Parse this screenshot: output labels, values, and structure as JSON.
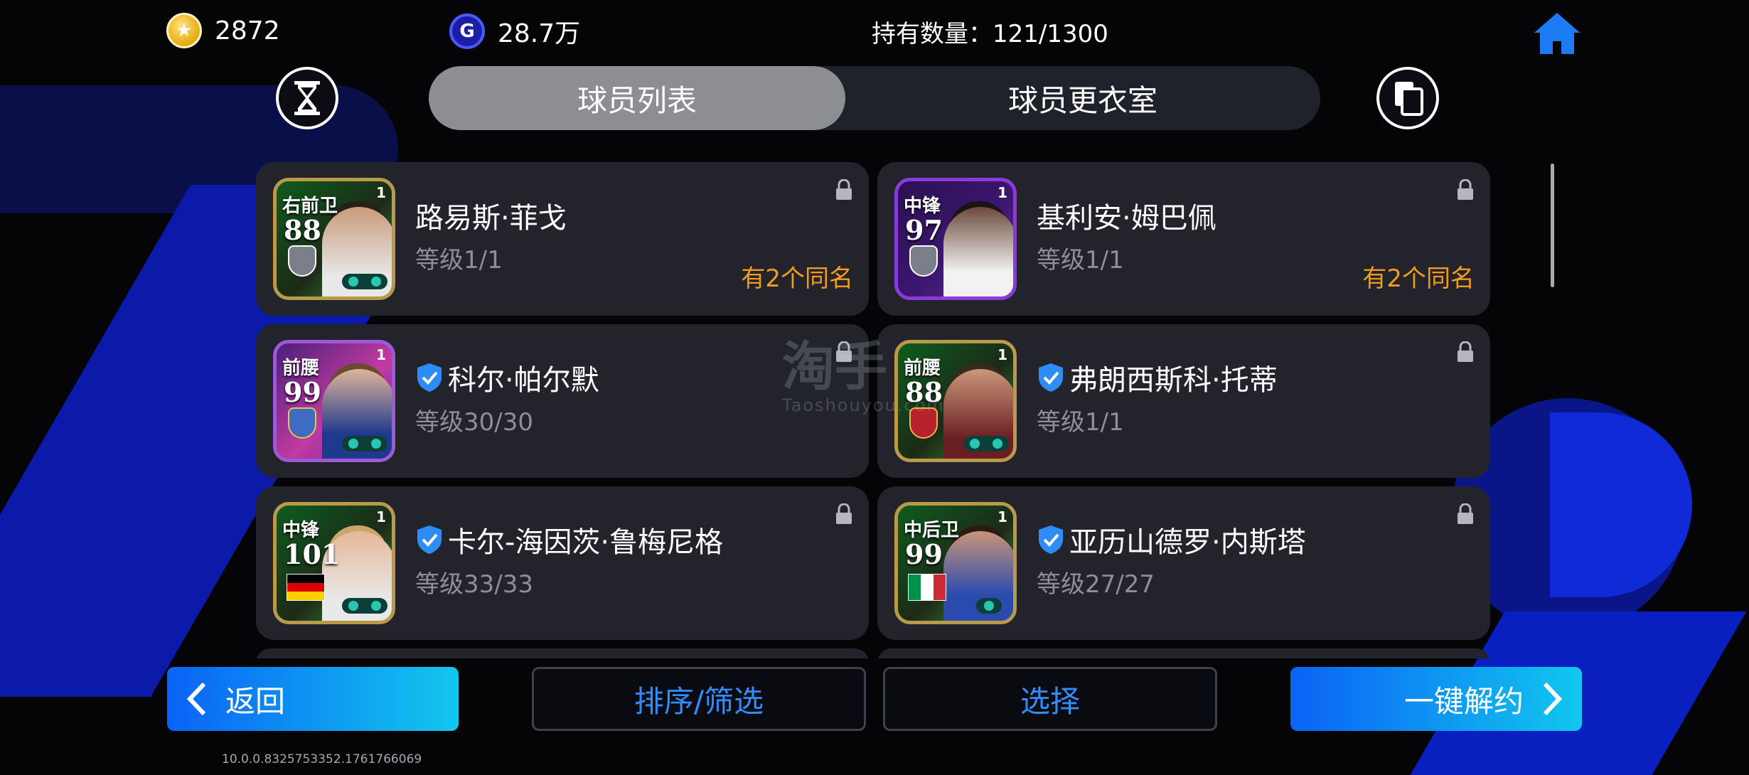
{
  "currency": {
    "coins": "2872",
    "gp": "28.7万",
    "holdings": "持有数量：121/1300"
  },
  "tabs": {
    "player_list": "球员列表",
    "locker_room": "球员更衣室"
  },
  "players": [
    {
      "position": "右前卫",
      "rating": "88",
      "name": "路易斯·菲戈",
      "level": "等级1/1",
      "duplicates": "有2个同名",
      "badge": "1"
    },
    {
      "position": "中锋",
      "rating": "97",
      "name": "基利安·姆巴佩",
      "level": "等级1/1",
      "duplicates": "有2个同名",
      "badge": "1"
    },
    {
      "position": "前腰",
      "rating": "99",
      "name": "科尔·帕尔默",
      "level": "等级30/30",
      "badge": "1"
    },
    {
      "position": "前腰",
      "rating": "88",
      "name": "弗朗西斯科·托蒂",
      "level": "等级1/1",
      "badge": "1"
    },
    {
      "position": "中锋",
      "rating": "101",
      "name": "卡尔-海因茨·鲁梅尼格",
      "level": "等级33/33",
      "badge": "1"
    },
    {
      "position": "中后卫",
      "rating": "99",
      "name": "亚历山德罗·内斯塔",
      "level": "等级27/27",
      "badge": "1"
    }
  ],
  "buttons": {
    "back": "返回",
    "sort_filter": "排序/筛选",
    "select": "选择",
    "release_all": "一键解约"
  },
  "watermark": {
    "main": "淘手",
    "sub": "Taoshouyou.com"
  },
  "version": "10.0.0.8325753352.1761766069",
  "colors": {
    "accent_blue": "#0a63f5",
    "duplicate_orange": "#f39b1e",
    "card_bg": "#23242b"
  },
  "icons": {
    "coin": "coin-icon",
    "gp": "gp-icon",
    "home": "home-icon",
    "history": "hourglass-icon",
    "copy": "copy-icon",
    "lock": "lock-icon",
    "verified": "verified-shield-icon"
  }
}
